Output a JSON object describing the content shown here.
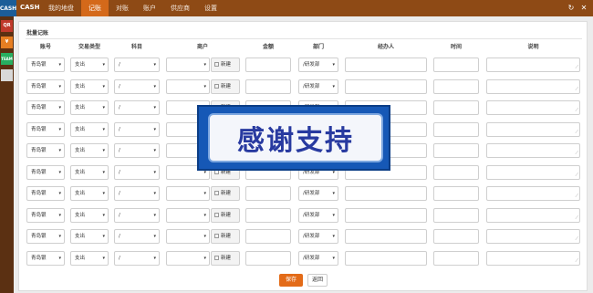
{
  "app": {
    "logo_text": "CASH",
    "name": "CASH"
  },
  "nav": [
    "我的地盘",
    "记账",
    "对账",
    "账户",
    "供应商",
    "设置"
  ],
  "nav_active_index": 1,
  "top_icons": {
    "refresh": "↻",
    "close": "✕"
  },
  "sidebar": [
    {
      "name": "qr-code-icon",
      "text": "QR"
    },
    {
      "name": "yen-icon",
      "text": "¥"
    },
    {
      "name": "team-icon",
      "text": "TEAM"
    },
    {
      "name": "grid-icon",
      "text": ""
    }
  ],
  "section_title": "批量记账",
  "columns": [
    "账号",
    "交易类型",
    "科目",
    "商户",
    "金额",
    "部门",
    "经办人",
    "时间",
    "说明"
  ],
  "row_defaults": {
    "account": "青岛银",
    "type": "支出",
    "subject": "/",
    "merchant": "",
    "new_label": "新建",
    "amount": "",
    "department": "/研发部",
    "handler": "",
    "time": "",
    "note": ""
  },
  "row_count": 10,
  "buttons": {
    "save": "保存",
    "back": "返回"
  },
  "overlay": {
    "text": "感谢支持"
  },
  "colors": {
    "topbar": "#8e4a15",
    "active_tab": "#d4691a",
    "save": "#e36b18",
    "overlay": "#1658b6"
  }
}
